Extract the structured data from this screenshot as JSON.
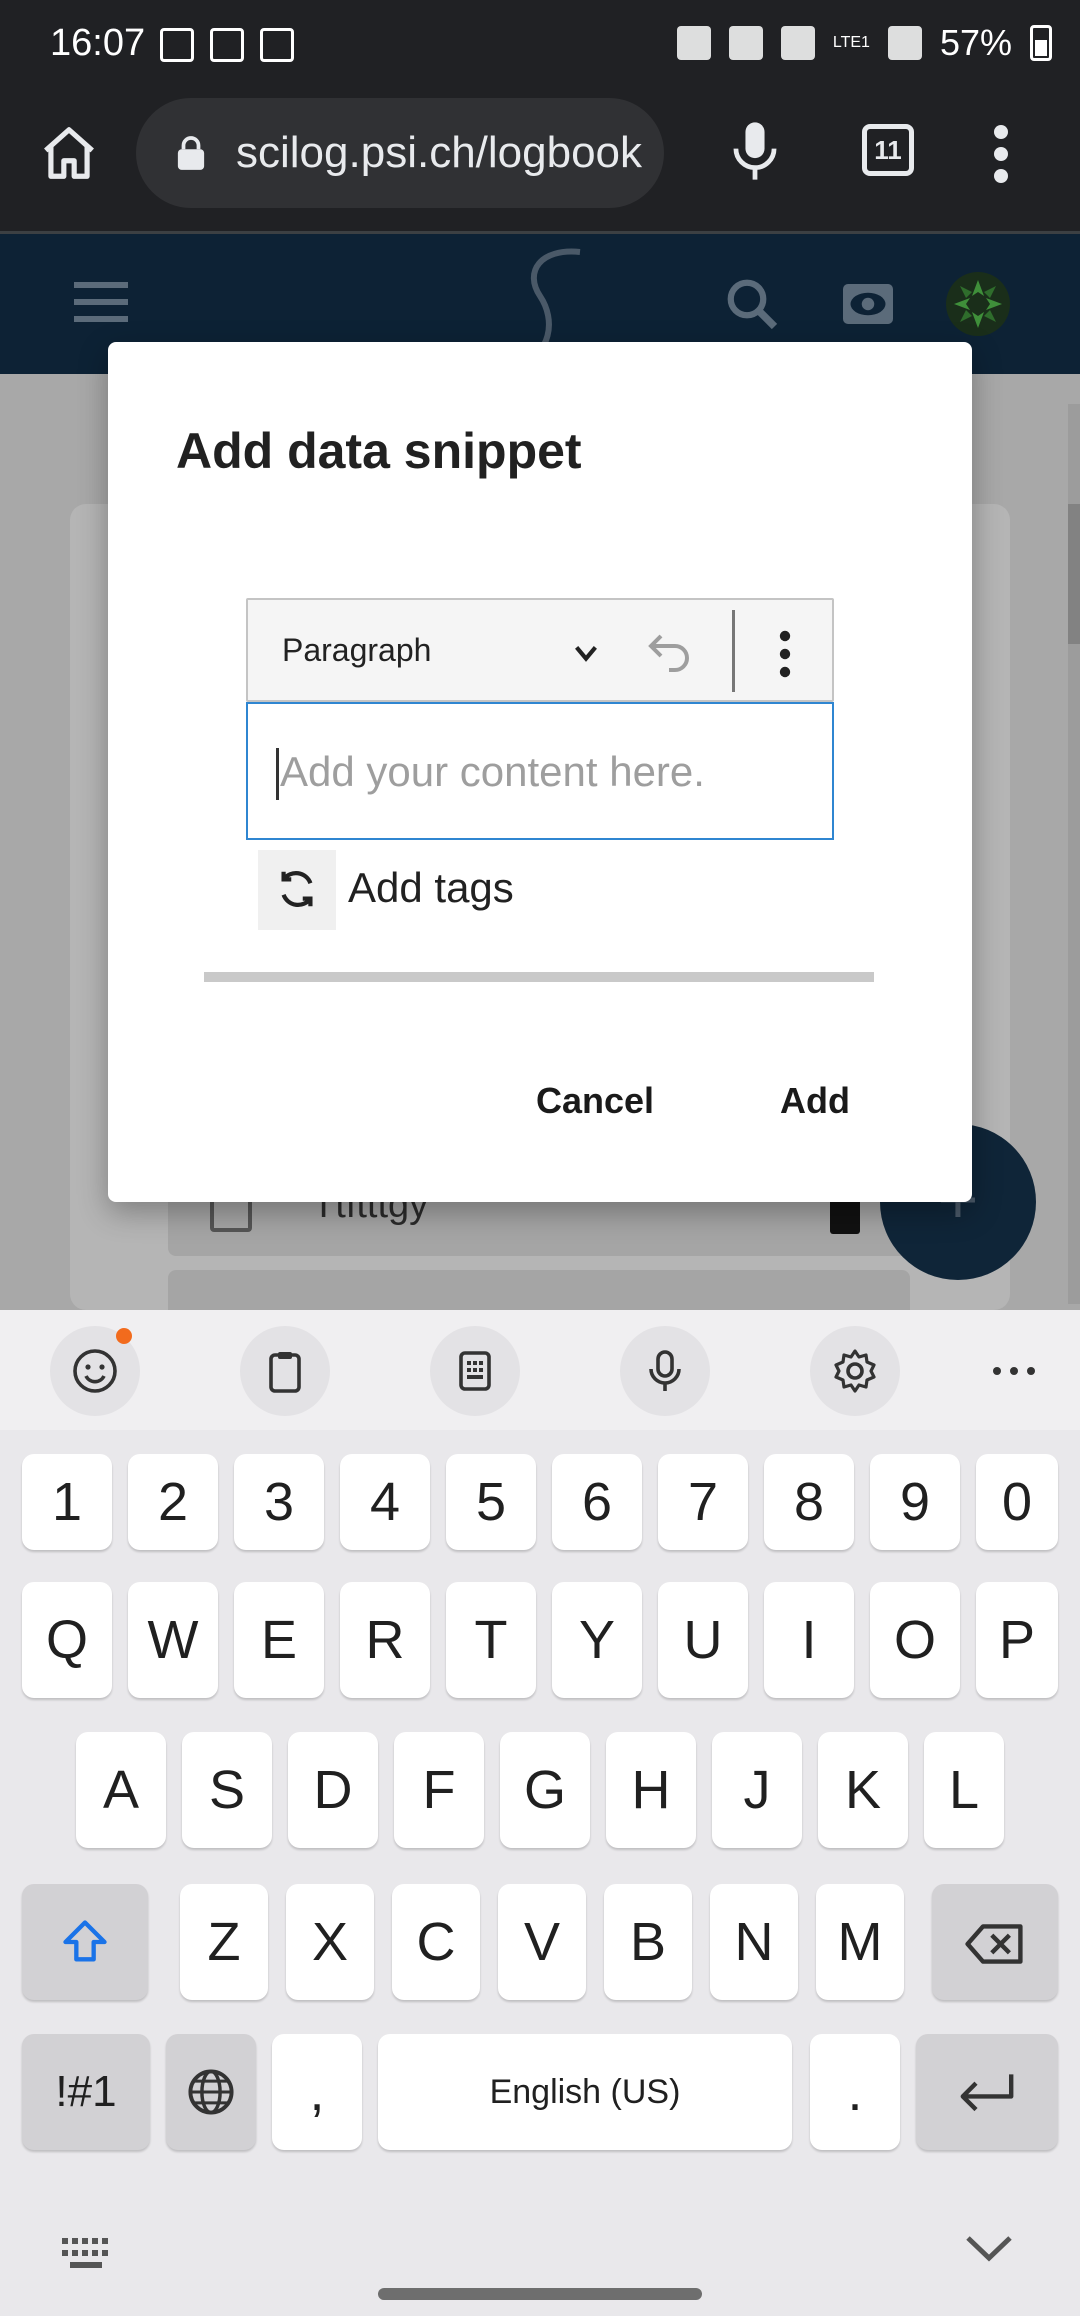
{
  "status_bar": {
    "time": "16:07",
    "battery": "57%",
    "network": "LTE1"
  },
  "browser": {
    "url": "scilog.psi.ch/logbook",
    "tab_count": "11"
  },
  "background": {
    "row_text": "Ttftttgy",
    "fab_label": "+"
  },
  "dialog": {
    "title": "Add data snippet",
    "toolbar": {
      "block_type": "Paragraph"
    },
    "editor_placeholder": "Add your content here.",
    "tags_label": "Add tags",
    "cancel_label": "Cancel",
    "add_label": "Add"
  },
  "keyboard": {
    "number_row": [
      "1",
      "2",
      "3",
      "4",
      "5",
      "6",
      "7",
      "8",
      "9",
      "0"
    ],
    "row_q": [
      "Q",
      "W",
      "E",
      "R",
      "T",
      "Y",
      "U",
      "I",
      "O",
      "P"
    ],
    "row_a": [
      "A",
      "S",
      "D",
      "F",
      "G",
      "H",
      "J",
      "K",
      "L"
    ],
    "row_z": [
      "Z",
      "X",
      "C",
      "V",
      "B",
      "N",
      "M"
    ],
    "symbols_label": "!#1",
    "comma": ",",
    "space_label": "English (US)",
    "period": "."
  },
  "colors": {
    "browser_bg": "#202124",
    "app_header": "#0d2235",
    "editor_focus": "#2f86d1",
    "shift_blue": "#1a73e8",
    "emoji_badge": "#f26b1d"
  }
}
